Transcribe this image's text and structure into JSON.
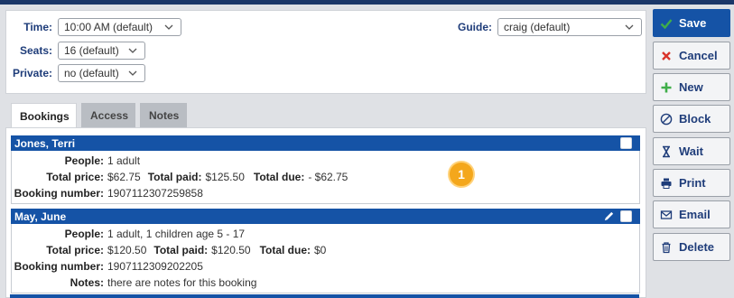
{
  "form": {
    "time": {
      "label": "Time:",
      "value": "10:00 AM (default)"
    },
    "seats": {
      "label": "Seats:",
      "value": "16 (default)"
    },
    "private": {
      "label": "Private:",
      "value": "no (default)"
    },
    "guide": {
      "label": "Guide:",
      "value": "craig (default)"
    }
  },
  "tabs": [
    {
      "label": "Bookings",
      "active": true
    },
    {
      "label": "Access",
      "active": false
    },
    {
      "label": "Notes",
      "active": false
    }
  ],
  "bookings": [
    {
      "name": "Jones, Terri",
      "people_label": "People:",
      "people": "1 adult",
      "total_price_label": "Total price:",
      "total_price": "$62.75",
      "total_paid_label": "Total paid:",
      "total_paid": "$125.50",
      "total_due_label": "Total due:",
      "total_due": "- $62.75",
      "booking_number_label": "Booking number:",
      "booking_number": "1907112307259858"
    },
    {
      "name": "May, June",
      "people_label": "People:",
      "people": "1 adult, 1 children age 5 - 17",
      "total_price_label": "Total price:",
      "total_price": "$120.50",
      "total_paid_label": "Total paid:",
      "total_paid": "$120.50",
      "total_due_label": "Total due:",
      "total_due": "$0",
      "booking_number_label": "Booking number:",
      "booking_number": "1907112309202205",
      "notes_label": "Notes:",
      "notes": "there are notes for this booking"
    }
  ],
  "badge": "1",
  "actions": {
    "save": "Save",
    "cancel": "Cancel",
    "new": "New",
    "block": "Block",
    "wait": "Wait",
    "print": "Print",
    "email": "Email",
    "delete": "Delete"
  },
  "colors": {
    "accent": "#1553a6",
    "header_bar": "#1b3768",
    "badge": "#f4a71c",
    "save_check": "#3fae49",
    "cancel_x": "#d9342b"
  }
}
